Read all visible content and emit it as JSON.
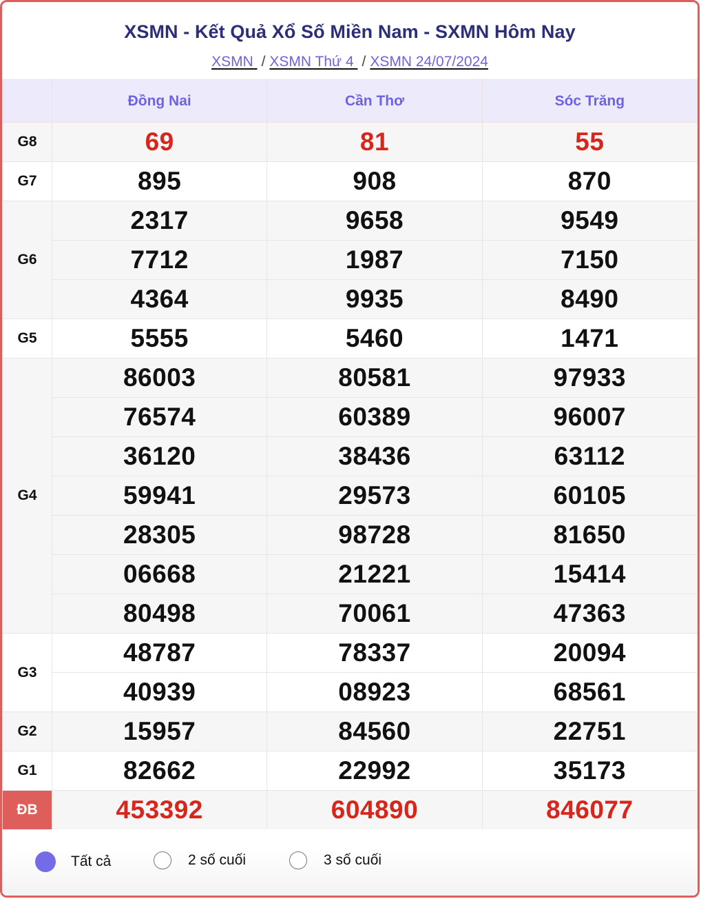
{
  "header": {
    "title": "XSMN - Kết Quả Xổ Số Miền Nam - SXMN Hôm Nay",
    "breadcrumb": [
      {
        "label": "XSMN "
      },
      {
        "label": "XSMN Thứ 4 "
      },
      {
        "label": "XSMN 24/07/2024"
      }
    ],
    "separator": "/"
  },
  "table": {
    "provinces": [
      "Đồng Nai",
      "Cần Thơ",
      "Sóc Trăng"
    ],
    "prizes": [
      {
        "label": "G8",
        "rows": [
          [
            "69",
            "81",
            "55"
          ]
        ]
      },
      {
        "label": "G7",
        "rows": [
          [
            "895",
            "908",
            "870"
          ]
        ]
      },
      {
        "label": "G6",
        "rows": [
          [
            "2317",
            "9658",
            "9549"
          ],
          [
            "7712",
            "1987",
            "7150"
          ],
          [
            "4364",
            "9935",
            "8490"
          ]
        ]
      },
      {
        "label": "G5",
        "rows": [
          [
            "5555",
            "5460",
            "1471"
          ]
        ]
      },
      {
        "label": "G4",
        "rows": [
          [
            "86003",
            "80581",
            "97933"
          ],
          [
            "76574",
            "60389",
            "96007"
          ],
          [
            "36120",
            "38436",
            "63112"
          ],
          [
            "59941",
            "29573",
            "60105"
          ],
          [
            "28305",
            "98728",
            "81650"
          ],
          [
            "06668",
            "21221",
            "15414"
          ],
          [
            "80498",
            "70061",
            "47363"
          ]
        ]
      },
      {
        "label": "G3",
        "rows": [
          [
            "48787",
            "78337",
            "20094"
          ],
          [
            "40939",
            "08923",
            "68561"
          ]
        ]
      },
      {
        "label": "G2",
        "rows": [
          [
            "15957",
            "84560",
            "22751"
          ]
        ]
      },
      {
        "label": "G1",
        "rows": [
          [
            "82662",
            "22992",
            "35173"
          ]
        ]
      },
      {
        "label": "ĐB",
        "rows": [
          [
            "453392",
            "604890",
            "846077"
          ]
        ]
      }
    ]
  },
  "filter": {
    "options": [
      {
        "label": "Tất cả",
        "selected": true
      },
      {
        "label": "2 số cuối",
        "selected": false
      },
      {
        "label": "3 số cuối",
        "selected": false
      }
    ]
  },
  "colors": {
    "border": "#dd5e5b",
    "title": "#2c2f78",
    "accent": "#6d63e0",
    "header_bg": "#edebfb",
    "highlight_number": "#d8261c",
    "radio_selected": "#736be8"
  }
}
